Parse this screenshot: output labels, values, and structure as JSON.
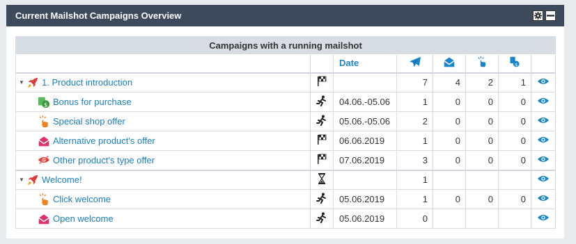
{
  "widget": {
    "title": "Current Mailshot Campaigns Overview"
  },
  "table": {
    "caption": "Campaigns with a running mailshot",
    "columns": {
      "date": "Date",
      "sent_icon": "paper-plane-icon",
      "opened_icon": "envelope-open-icon",
      "clicked_icon": "click-icon",
      "converted_icon": "conversion-icon"
    },
    "rows": [
      {
        "name": "1. Product introduction",
        "status": "finished",
        "date": "",
        "sent": "7",
        "opened": "4",
        "clicked": "2",
        "converted": "1"
      },
      {
        "name": "Bonus for purchase",
        "status": "running",
        "date": "04.06.-05.06",
        "sent": "1",
        "opened": "0",
        "clicked": "0",
        "converted": "0"
      },
      {
        "name": "Special shop offer",
        "status": "running",
        "date": "05.06.-05.06",
        "sent": "2",
        "opened": "0",
        "clicked": "0",
        "converted": "0"
      },
      {
        "name": "Alternative product's offer",
        "status": "finished",
        "date": "06.06.2019",
        "sent": "1",
        "opened": "0",
        "clicked": "0",
        "converted": "0"
      },
      {
        "name": "Other product's type offer",
        "status": "finished",
        "date": "07.06.2019",
        "sent": "3",
        "opened": "0",
        "clicked": "0",
        "converted": "0"
      },
      {
        "name": "Welcome!",
        "status": "waiting",
        "date": "",
        "sent": "1",
        "opened": "",
        "clicked": "",
        "converted": ""
      },
      {
        "name": "Click welcome",
        "status": "running",
        "date": "05.06.2019",
        "sent": "1",
        "opened": "0",
        "clicked": "0",
        "converted": "0"
      },
      {
        "name": "Open welcome",
        "status": "running",
        "date": "05.06.2019",
        "sent": "0",
        "opened": "",
        "clicked": "",
        "converted": ""
      }
    ]
  },
  "colors": {
    "header_bg": "#3c4a5c",
    "link": "#1a7fc1",
    "accent_blue": "#1a86c9"
  }
}
